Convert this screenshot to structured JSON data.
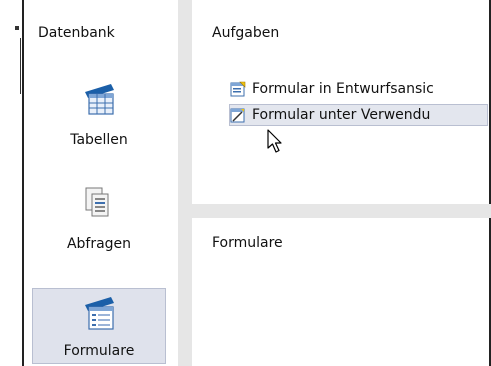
{
  "sidebar": {
    "title": "Datenbank",
    "items": [
      {
        "label": "Tabellen",
        "icon": "table-icon",
        "selected": false
      },
      {
        "label": "Abfragen",
        "icon": "query-icon",
        "selected": false
      },
      {
        "label": "Formulare",
        "icon": "form-icon",
        "selected": true
      }
    ]
  },
  "tasks_panel": {
    "title": "Aufgaben",
    "items": [
      {
        "label": "Formular in Entwurfsansic",
        "icon": "form-design-icon"
      },
      {
        "label": "Formular unter Verwendu",
        "icon": "form-wizard-icon"
      }
    ]
  },
  "forms_panel": {
    "title": "Formulare"
  },
  "colors": {
    "selected_bg": "#dfe2ec",
    "separator": "#e6e6e6",
    "border": "#222222"
  }
}
